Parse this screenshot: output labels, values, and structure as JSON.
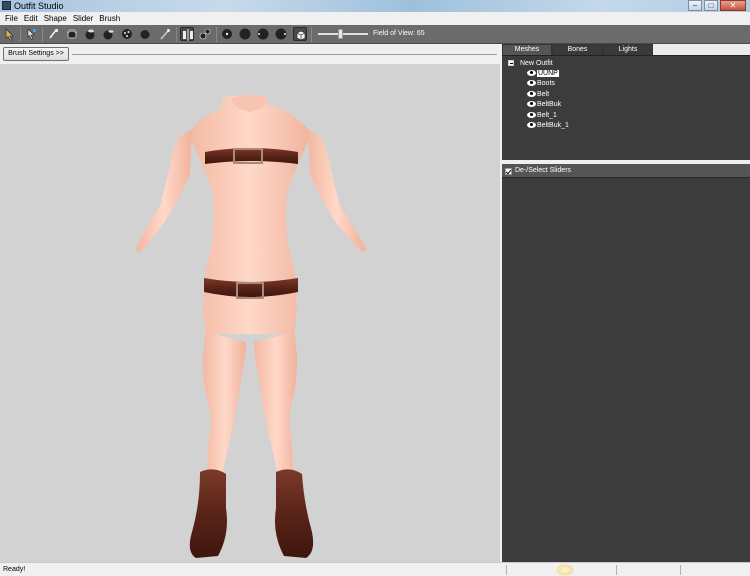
{
  "window": {
    "title": "Outfit Studio",
    "controls": [
      "minimize",
      "maximize",
      "close"
    ]
  },
  "menu": [
    "File",
    "Edit",
    "Shape",
    "Slider",
    "Brush"
  ],
  "toolbar": {
    "tools": [
      {
        "icon": "select-icon"
      },
      {
        "icon": "transform-icon"
      },
      {
        "icon": "inflate-brush-icon"
      },
      {
        "icon": "deflate-brush-icon"
      },
      {
        "icon": "move-brush-icon"
      },
      {
        "icon": "smooth-brush-icon"
      },
      {
        "icon": "mask-brush-icon"
      },
      {
        "icon": "unmask-brush-icon"
      },
      {
        "icon": "weight-brush-icon"
      },
      {
        "icon": "edit-brush-icon"
      },
      {
        "icon": "mirror-x-icon"
      },
      {
        "icon": "connected-only-icon"
      },
      {
        "icon": "brush-size-small-icon"
      },
      {
        "icon": "brush-size-medium-icon"
      },
      {
        "icon": "brush-size-large-icon"
      },
      {
        "icon": "brush-size-xlarge-icon"
      },
      {
        "icon": "wireframe-cube-icon"
      }
    ],
    "fov_label": "Field of View: 65",
    "fov_value": 65
  },
  "brush_settings_button": "Brush Settings >>",
  "tabs": [
    "Meshes",
    "Bones",
    "Lights"
  ],
  "active_tab": "Meshes",
  "tree": {
    "root": "New Outfit",
    "items": [
      {
        "label": "UUNP",
        "selected": true
      },
      {
        "label": "Boots",
        "selected": false
      },
      {
        "label": "Belt",
        "selected": false
      },
      {
        "label": "BeltBuk",
        "selected": false
      },
      {
        "label": "Belt_1",
        "selected": false
      },
      {
        "label": "BeltBuk_1",
        "selected": false
      }
    ]
  },
  "sliders": {
    "header": "De-/Select Sliders",
    "checked": true
  },
  "status": {
    "text": "Ready!"
  },
  "colors": {
    "viewport": "#d2d2d2",
    "panel_dark": "#3c3c3c",
    "toolbar": "#6b6b6b"
  }
}
